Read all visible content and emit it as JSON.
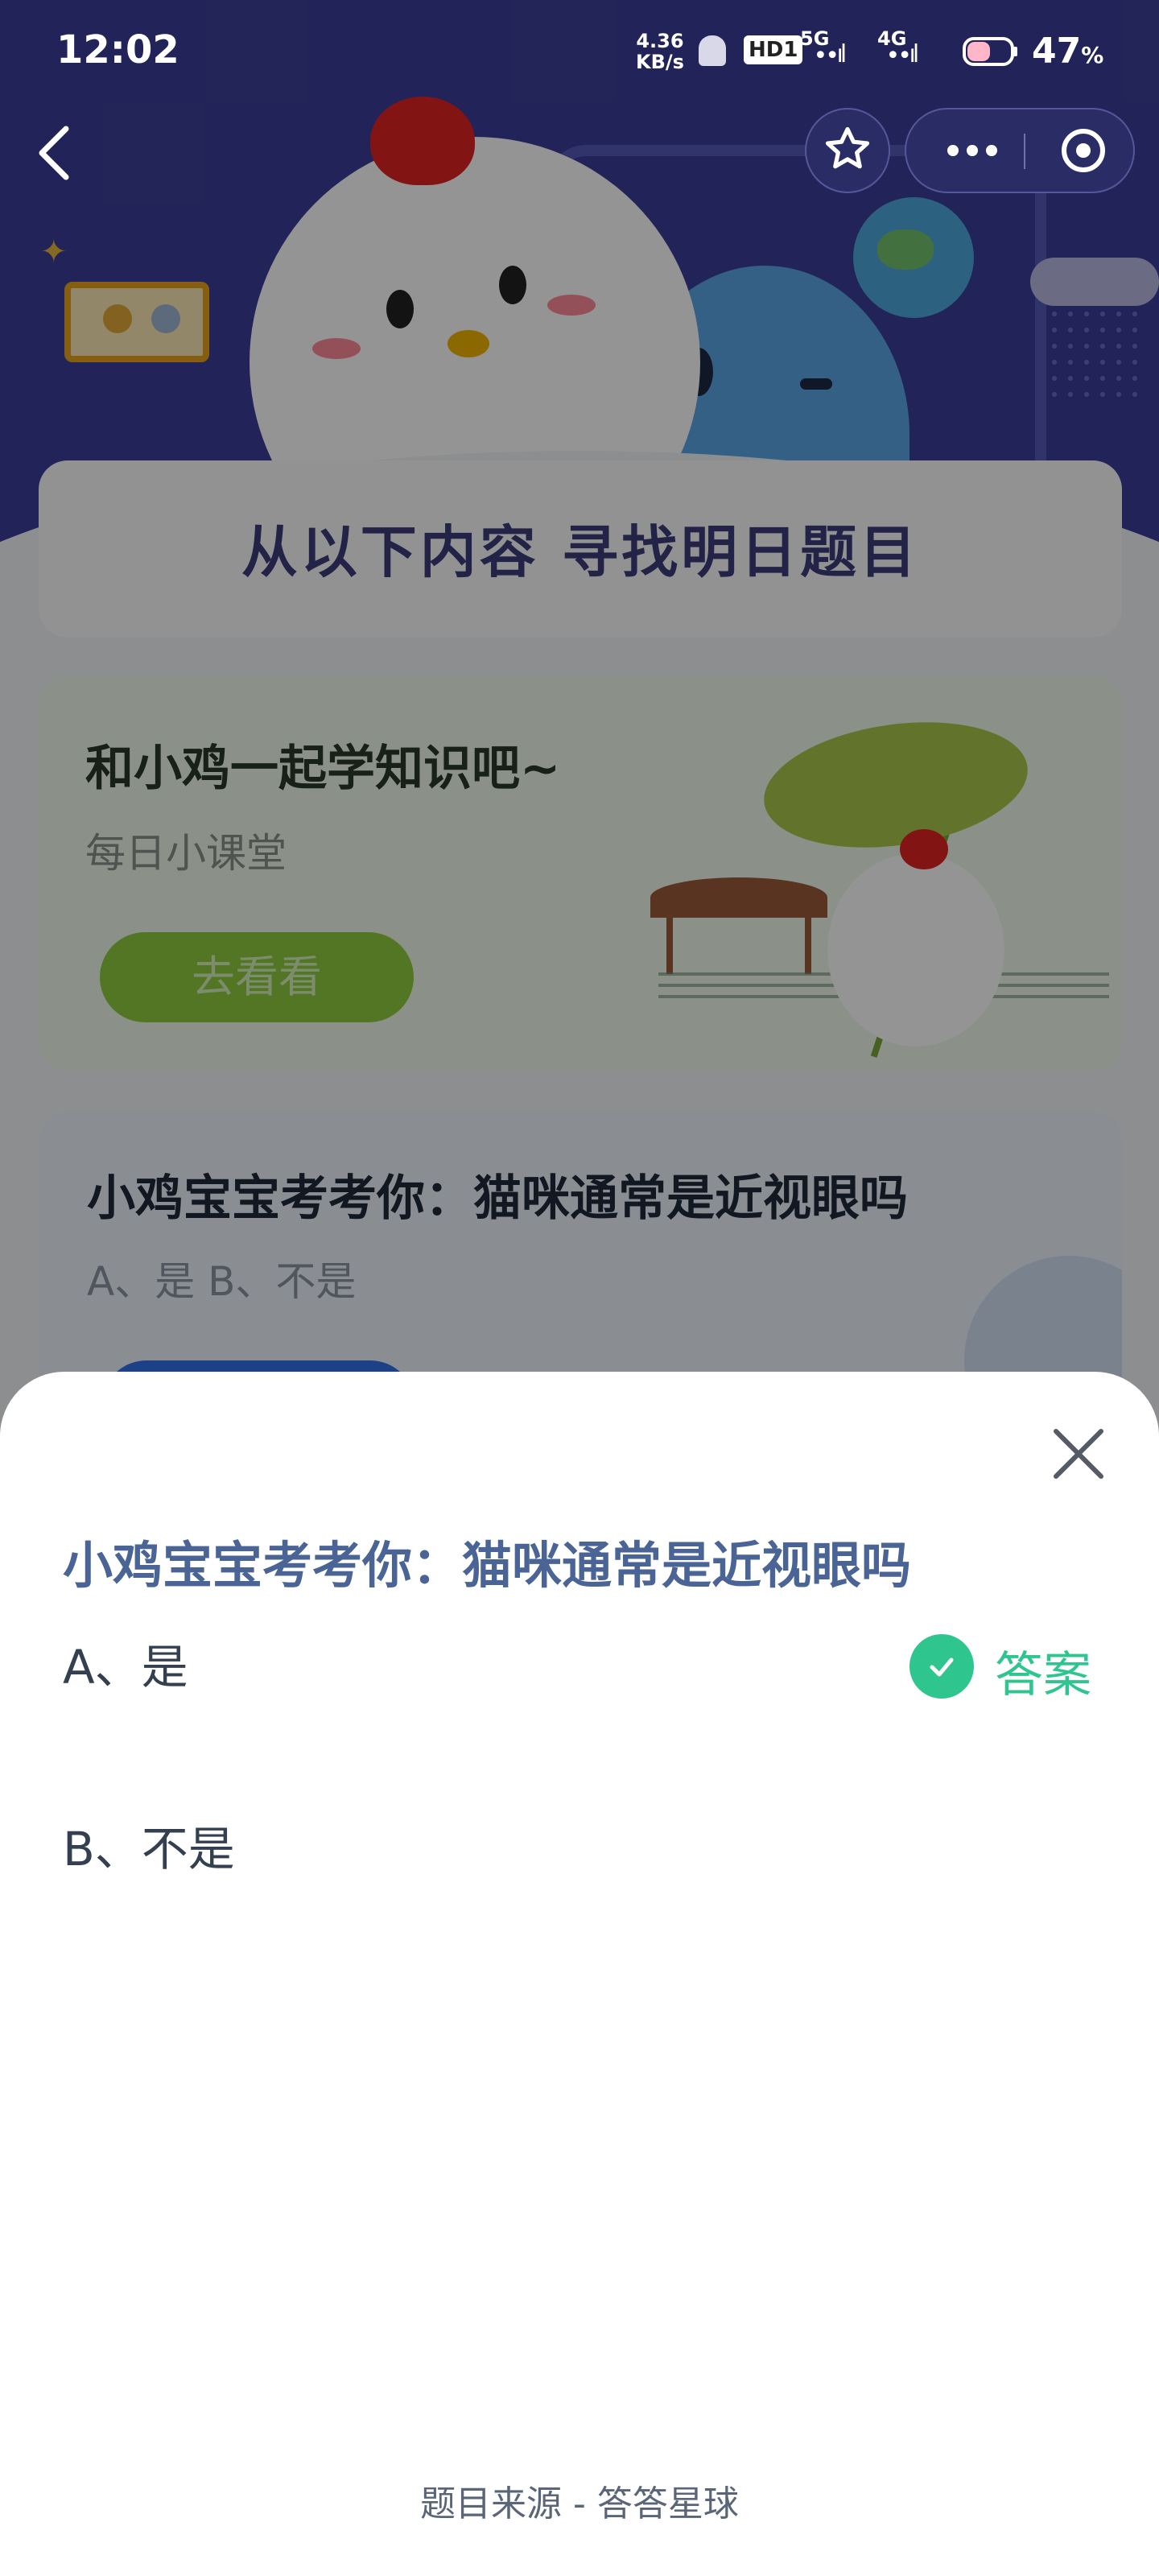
{
  "status_bar": {
    "time": "12:02",
    "net_speed_value": "4.36",
    "net_speed_unit": "KB/s",
    "hd_badge": "HD1",
    "network_1": "5G",
    "network_2": "4G",
    "battery_percent": "47",
    "battery_unit": "%"
  },
  "top_bar": {
    "back_icon": "chevron-left-icon",
    "favorite_icon": "star-icon",
    "more_icon": "more-dots-icon",
    "target_icon": "target-icon"
  },
  "background": {
    "find_title": "从以下内容  寻找明日题目",
    "learn_card": {
      "title": "和小鸡一起学知识吧~",
      "subtitle": "每日小课堂",
      "button_label": "去看看"
    },
    "quiz_card": {
      "question": "小鸡宝宝考考你：猫咪通常是近视眼吗",
      "options_text": "A、是     B、不是"
    }
  },
  "sheet": {
    "question": "小鸡宝宝考考你：猫咪通常是近视眼吗",
    "options": [
      {
        "label": "A、是",
        "is_answer": true
      },
      {
        "label": "B、不是",
        "is_answer": false
      }
    ],
    "answer_label": "答案",
    "answer_color": "#2fc58e",
    "title_color": "#4a6496",
    "close_icon": "close-icon",
    "source_text": "题目来源 - 答答星球"
  }
}
